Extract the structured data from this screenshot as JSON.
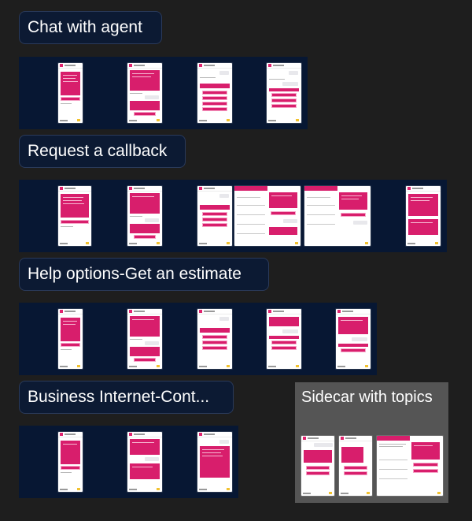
{
  "sections": {
    "chat_with_agent": "Chat with agent",
    "request_callback": "Request a callback",
    "help_options": "Help options-Get an estimate",
    "business_internet": "Business Internet-Cont...",
    "sidecar": "Sidecar with topics"
  },
  "colors": {
    "background": "#1e1e1e",
    "strip": "#071733",
    "label_bg": "#0c1a33",
    "accent_pink": "#d81e6c",
    "sidecar_panel": "#555555"
  }
}
